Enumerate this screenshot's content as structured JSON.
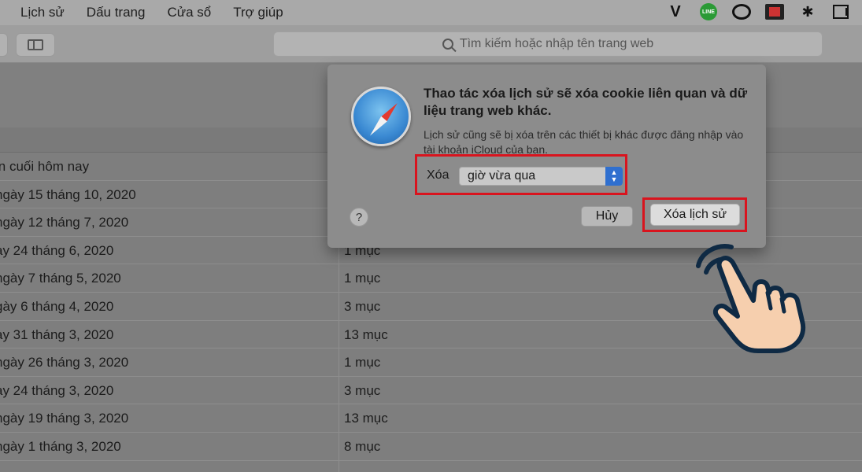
{
  "menubar": {
    "items": [
      "Lịch sử",
      "Dấu trang",
      "Cửa sổ",
      "Trợ giúp"
    ],
    "tray_v": "V",
    "tray_line": "LINE"
  },
  "toolbar": {
    "search_placeholder": "Tìm kiếm hoặc nhập tên trang web"
  },
  "history": {
    "rows": [
      {
        "date": "in cuối hôm nay",
        "count": ""
      },
      {
        "date": "ngày 15 tháng 10, 2020",
        "count": ""
      },
      {
        "date": "ngày 12 tháng 7, 2020",
        "count": ""
      },
      {
        "date": "ày 24 tháng 6, 2020",
        "count": "1 mục"
      },
      {
        "date": "ngày 7 tháng 5, 2020",
        "count": "1 mục"
      },
      {
        "date": "gày 6 tháng 4, 2020",
        "count": "3 mục"
      },
      {
        "date": "ày 31 tháng 3, 2020",
        "count": "13 mục"
      },
      {
        "date": "ngày 26 tháng 3, 2020",
        "count": "1 mục"
      },
      {
        "date": "ày 24 tháng 3, 2020",
        "count": "3 mục"
      },
      {
        "date": "ngày 19 tháng 3, 2020",
        "count": "13 mục"
      },
      {
        "date": "ngày 1 tháng 3, 2020",
        "count": "8 mục"
      }
    ]
  },
  "dialog": {
    "title": "Thao tác xóa lịch sử sẽ xóa cookie liên quan và dữ liệu trang web khác.",
    "subtitle": "Lịch sử cũng sẽ bị xóa trên các thiết bị khác được đăng nhập vào tài khoản iCloud của bạn.",
    "select_label": "Xóa",
    "select_value": "giờ vừa qua",
    "help": "?",
    "cancel": "Hủy",
    "clear": "Xóa lịch sử"
  },
  "colors": {
    "highlight": "#d9141e",
    "select_accent": "#2f6fcf"
  }
}
